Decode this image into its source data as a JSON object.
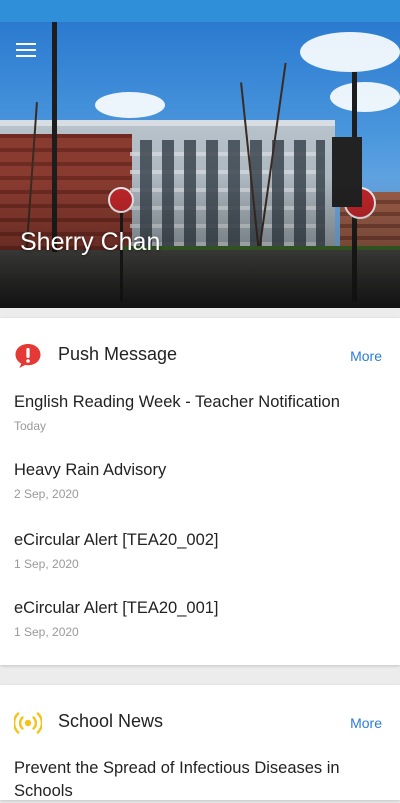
{
  "header": {
    "user_name": "Sherry Chan"
  },
  "push_message": {
    "title": "Push Message",
    "more_label": "More",
    "items": [
      {
        "title": "English Reading Week - Teacher Notification",
        "date": "Today"
      },
      {
        "title": "Heavy Rain Advisory",
        "date": "2 Sep, 2020"
      },
      {
        "title": "eCircular Alert [TEA20_002]",
        "date": "1 Sep, 2020"
      },
      {
        "title": "eCircular Alert [TEA20_001]",
        "date": "1 Sep, 2020"
      }
    ]
  },
  "school_news": {
    "title": "School News",
    "more_label": "More",
    "items": [
      {
        "title": "Prevent the Spread of Infectious Diseases in Schools"
      }
    ]
  },
  "colors": {
    "status_bar": "#2f8fd8",
    "accent_link": "#2c7cd8",
    "push_icon": "#e53935",
    "news_icon": "#f4c21b"
  }
}
